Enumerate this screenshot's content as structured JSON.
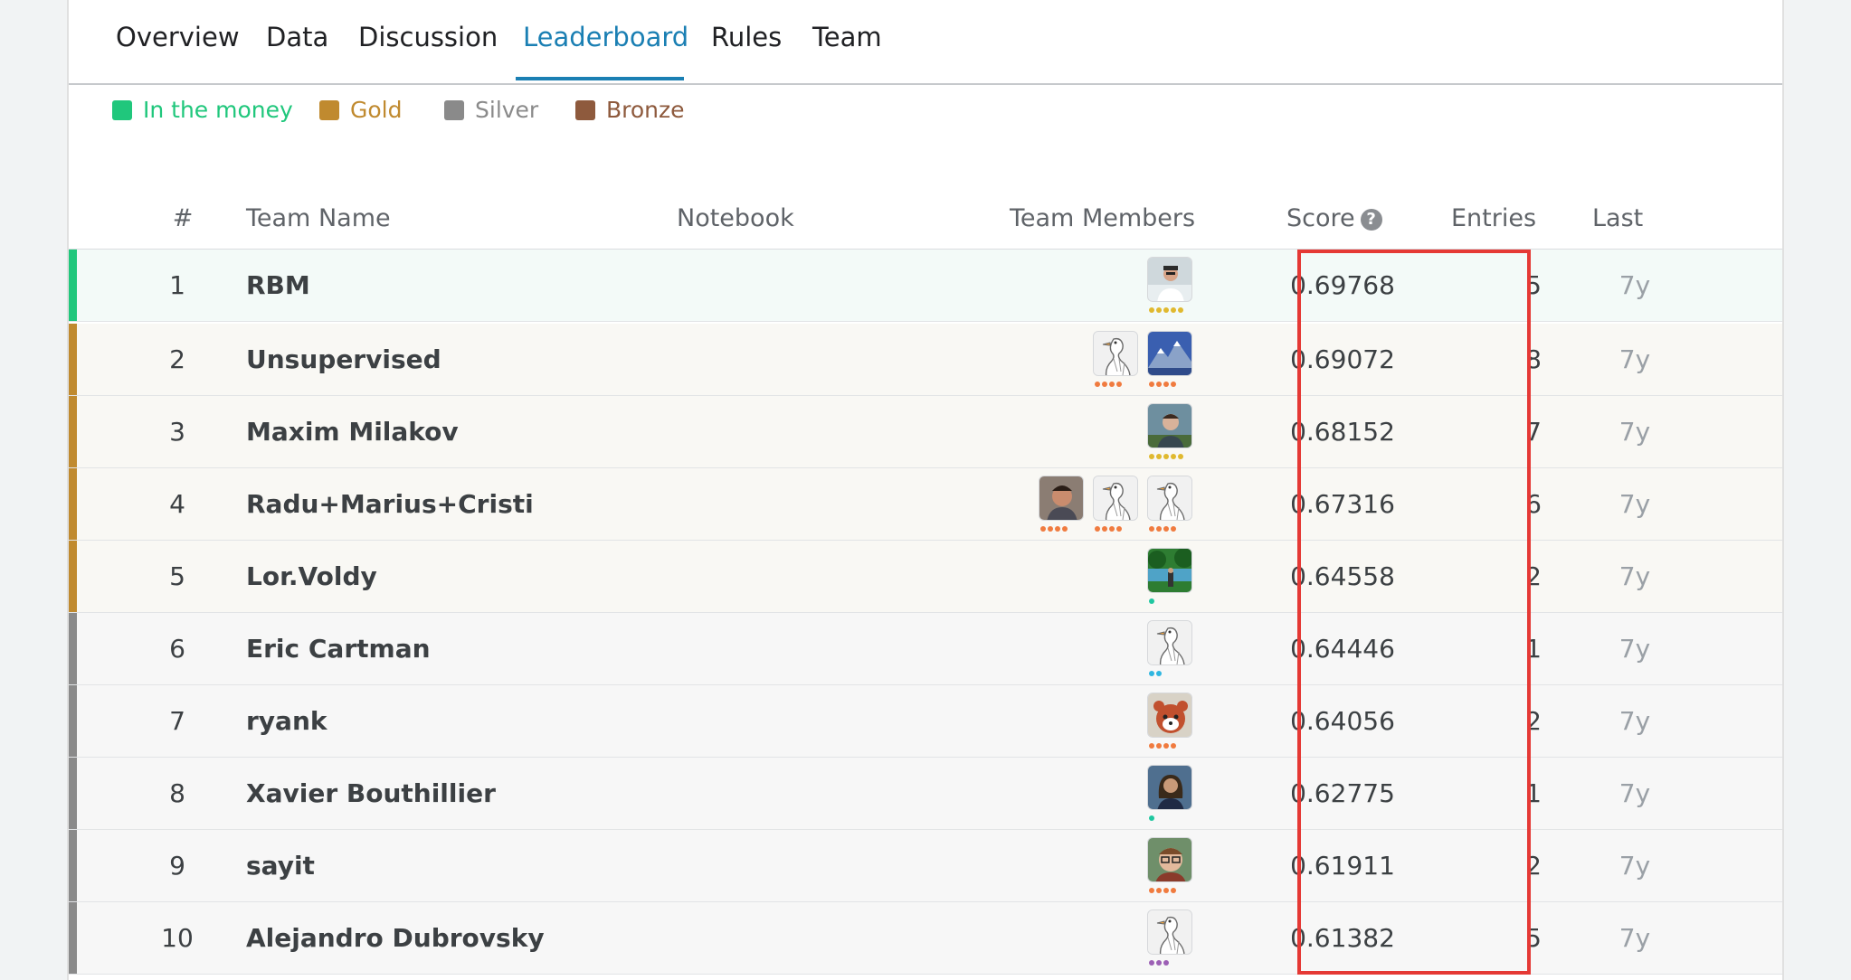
{
  "tabs": [
    {
      "label": "Overview",
      "active": false
    },
    {
      "label": "Data",
      "active": false
    },
    {
      "label": "Discussion",
      "active": false
    },
    {
      "label": "Leaderboard",
      "active": true
    },
    {
      "label": "Rules",
      "active": false
    },
    {
      "label": "Team",
      "active": false
    }
  ],
  "legend": [
    {
      "label": "In the money",
      "color": "#20c77c",
      "text_color": "#20c77c"
    },
    {
      "label": "Gold",
      "color": "#c08a2f",
      "text_color": "#c08a2f"
    },
    {
      "label": "Silver",
      "color": "#8a8a8a",
      "text_color": "#8a8a8a"
    },
    {
      "label": "Bronze",
      "color": "#8e5a3d",
      "text_color": "#8e5a3d"
    }
  ],
  "columns": {
    "rank": "#",
    "team_name": "Team Name",
    "notebook": "Notebook",
    "team_members": "Team Members",
    "score": "Score",
    "entries": "Entries",
    "last": "Last"
  },
  "help_icon": "question-circle-icon",
  "rows": [
    {
      "rank": "1",
      "team": "RBM",
      "score": "0.69768",
      "entries": "5",
      "last": "7y",
      "medal": "money",
      "bar_color": "#20c77c",
      "bg": "#f3faf8",
      "members": [
        {
          "icon": "avatar-photo-man-white-shirt",
          "tier_color": "#e0b92f",
          "tier_dots": 5
        }
      ]
    },
    {
      "rank": "2",
      "team": "Unsupervised",
      "score": "0.69072",
      "entries": "8",
      "last": "7y",
      "medal": "gold",
      "bar_color": "#c08a2f",
      "bg": "#f9f8f4",
      "members": [
        {
          "icon": "avatar-goose-default",
          "tier_color": "#f07b3f",
          "tier_dots": 4
        },
        {
          "icon": "avatar-photo-mountains",
          "tier_color": "#f07b3f",
          "tier_dots": 4
        }
      ]
    },
    {
      "rank": "3",
      "team": "Maxim Milakov",
      "score": "0.68152",
      "entries": "7",
      "last": "7y",
      "medal": "gold",
      "bar_color": "#c08a2f",
      "bg": "#f9f8f4",
      "members": [
        {
          "icon": "avatar-photo-man-outdoor",
          "tier_color": "#e0b92f",
          "tier_dots": 5
        }
      ]
    },
    {
      "rank": "4",
      "team": "Radu+Marius+Cristi",
      "score": "0.67316",
      "entries": "6",
      "last": "7y",
      "medal": "gold",
      "bar_color": "#c08a2f",
      "bg": "#f9f8f4",
      "members": [
        {
          "icon": "avatar-photo-man-face",
          "tier_color": "#f07b3f",
          "tier_dots": 4
        },
        {
          "icon": "avatar-goose-default",
          "tier_color": "#f07b3f",
          "tier_dots": 4
        },
        {
          "icon": "avatar-goose-default",
          "tier_color": "#f07b3f",
          "tier_dots": 4
        }
      ]
    },
    {
      "rank": "5",
      "team": "Lor.Voldy",
      "score": "0.64558",
      "entries": "2",
      "last": "7y",
      "medal": "gold",
      "bar_color": "#c08a2f",
      "bg": "#f9f8f4",
      "members": [
        {
          "icon": "avatar-photo-lake-trees",
          "tier_color": "#20c7a0",
          "tier_dots": 1
        }
      ]
    },
    {
      "rank": "6",
      "team": "Eric Cartman",
      "score": "0.64446",
      "entries": "1",
      "last": "7y",
      "medal": "silver",
      "bar_color": "#8a8a8a",
      "bg": "#f7f7f7",
      "members": [
        {
          "icon": "avatar-goose-default",
          "tier_color": "#2fb6e0",
          "tier_dots": 2
        }
      ]
    },
    {
      "rank": "7",
      "team": "ryank",
      "score": "0.64056",
      "entries": "2",
      "last": "7y",
      "medal": "silver",
      "bar_color": "#8a8a8a",
      "bg": "#f7f7f7",
      "members": [
        {
          "icon": "avatar-photo-red-panda",
          "tier_color": "#f07b3f",
          "tier_dots": 4
        }
      ]
    },
    {
      "rank": "8",
      "team": "Xavier Bouthillier",
      "score": "0.62775",
      "entries": "1",
      "last": "7y",
      "medal": "silver",
      "bar_color": "#8a8a8a",
      "bg": "#f7f7f7",
      "members": [
        {
          "icon": "avatar-photo-woman-dark",
          "tier_color": "#20c7a0",
          "tier_dots": 1
        }
      ]
    },
    {
      "rank": "9",
      "team": "sayit",
      "score": "0.61911",
      "entries": "2",
      "last": "7y",
      "medal": "silver",
      "bar_color": "#8a8a8a",
      "bg": "#f7f7f7",
      "members": [
        {
          "icon": "avatar-photo-man-glasses",
          "tier_color": "#f07b3f",
          "tier_dots": 4
        }
      ]
    },
    {
      "rank": "10",
      "team": "Alejandro Dubrovsky",
      "score": "0.61382",
      "entries": "5",
      "last": "7y",
      "medal": "silver",
      "bar_color": "#8a8a8a",
      "bg": "#f7f7f7",
      "members": [
        {
          "icon": "avatar-goose-default",
          "tier_color": "#9c5fb5",
          "tier_dots": 3
        }
      ]
    }
  ],
  "highlight_color": "#e53935"
}
